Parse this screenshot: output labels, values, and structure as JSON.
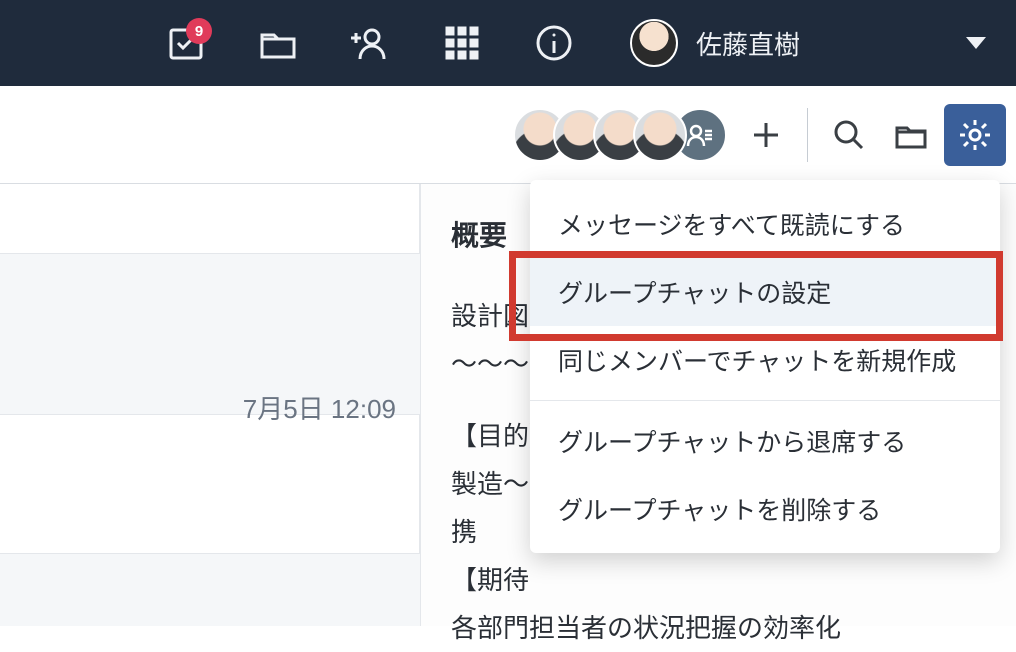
{
  "topbar": {
    "badge_count": "9",
    "user_name": "佐藤直樹"
  },
  "timestamp": "7月5日 12:09",
  "overview": {
    "title": "概要",
    "line1": "設計図",
    "line2": "～～～",
    "line3": "【目的】",
    "line4_a": "製造～",
    "line4_b": "携",
    "line5": "【期待",
    "line6": "各部門担当者の状況把握の効率化"
  },
  "dropdown": {
    "items": [
      "メッセージをすべて既読にする",
      "グループチャットの設定",
      "同じメンバーでチャットを新規作成",
      "グループチャットから退席する",
      "グループチャットを削除する"
    ]
  }
}
